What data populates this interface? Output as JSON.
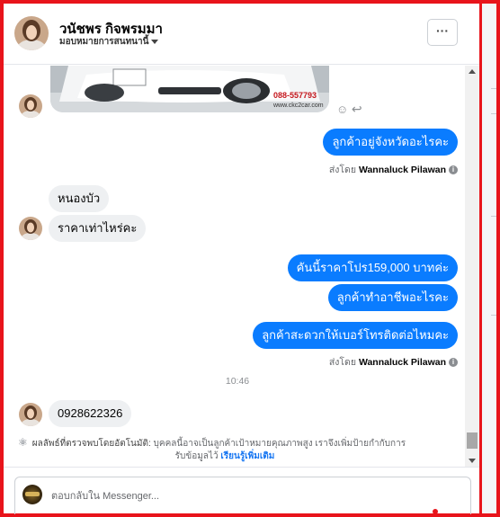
{
  "header": {
    "name": "วนัชพร กิจพรมมา",
    "assign_label": "มอบหมายการสนทนานี้",
    "more_label": "···"
  },
  "photo": {
    "watermark_phone": "088-557793",
    "watermark_site": "www.ckc2car.com"
  },
  "messages": {
    "out1": "ลูกค้าอยู่จังหวัดอะไรคะ",
    "sent_by_label": "ส่งโดย",
    "sent_by_name": "Wannaluck Pilawan",
    "in1": "หนองบัว",
    "in2": "ราคาเท่าไหร่คะ",
    "out2": "คันนี้ราคาโปร159,000  บาทค่ะ",
    "out3": "ลูกค้าทำอาชีพอะไรคะ",
    "out4": "ลูกค้าสะดวกให้เบอร์โทรติดต่อไหมคะ",
    "timestamp": "10:46",
    "in3": "0928622326"
  },
  "auto_detect": {
    "label": "ผลลัพธ์ที่ตรวจพบโดยอัตโนมัติ:",
    "text_line1": "บุคคลนี้อาจเป็นลูกค้าเป้าหมายคุณภาพสูง เราจึงเพิ่มป้ายกำกับการ",
    "text_line2": "รับข้อมูลไว้",
    "learn_more": "เรียนรู้เพิ่มเติม"
  },
  "reply": {
    "placeholder": "ตอบกลับใน Messenger..."
  },
  "colors": {
    "frame_red": "#e8141b",
    "bubble_blue": "#0a7cff",
    "bubble_gray": "#eef0f2",
    "link_blue": "#1877f2"
  },
  "icons": [
    "more-options-icon",
    "emoji-icon",
    "reply-arrow-icon",
    "info-icon",
    "auto-detect-icon",
    "dropdown-caret-icon"
  ]
}
